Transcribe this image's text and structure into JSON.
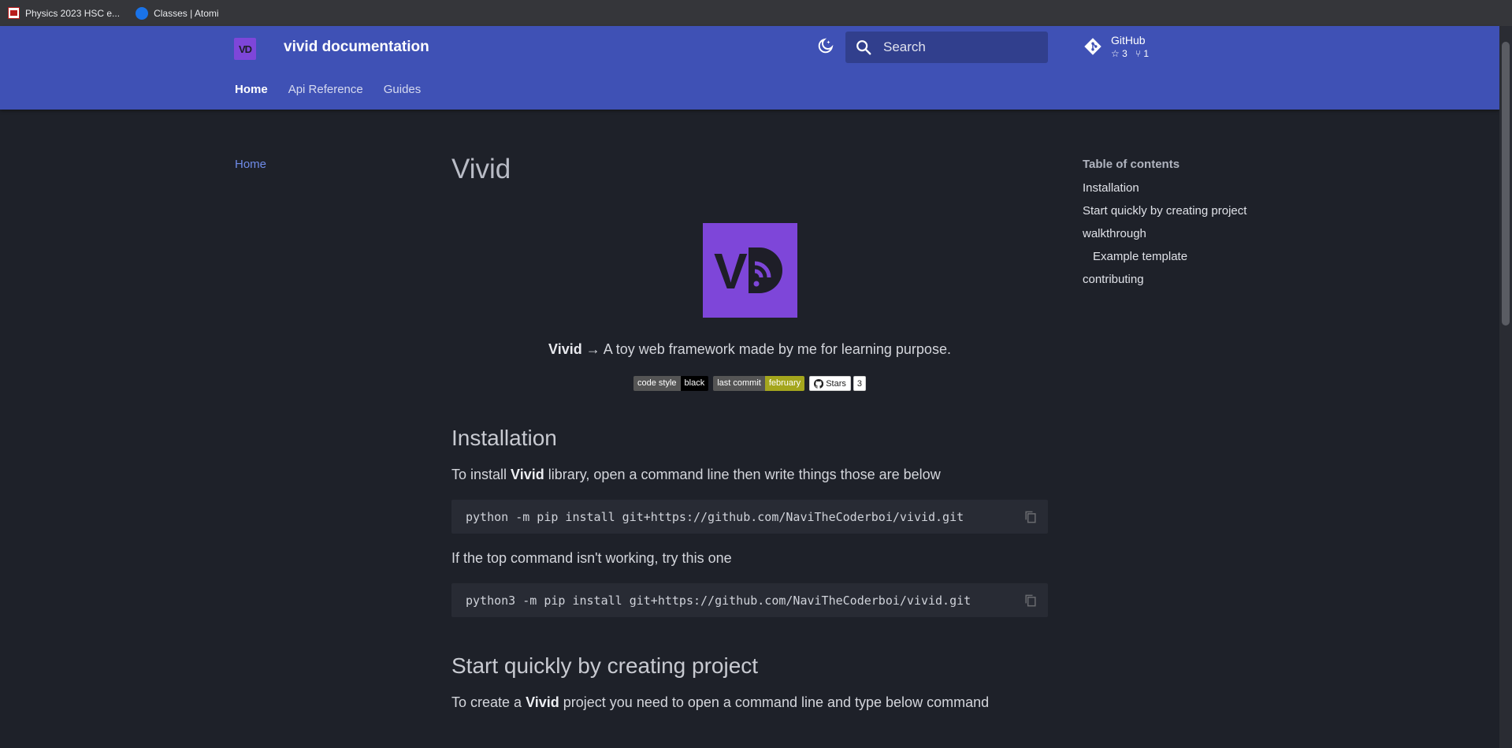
{
  "bookmarks": [
    {
      "label": "Physics 2023 HSC e..."
    },
    {
      "label": "Classes | Atomi"
    }
  ],
  "header": {
    "logo_text": "VD",
    "site_title": "vivid documentation",
    "search_placeholder": "Search",
    "repo": {
      "name": "GitHub",
      "stars": "3",
      "forks": "1"
    },
    "tabs": [
      {
        "label": "Home",
        "active": true
      },
      {
        "label": "Api Reference",
        "active": false
      },
      {
        "label": "Guides",
        "active": false
      }
    ]
  },
  "sidebar": {
    "items": [
      {
        "label": "Home"
      }
    ]
  },
  "main": {
    "title": "Vivid",
    "hero_logo_text": "VD",
    "tagline_bold": "Vivid",
    "tagline_rest": " → A toy web framework made by me for learning purpose.",
    "badges": [
      {
        "key": "code style",
        "value": "black"
      },
      {
        "key": "last commit",
        "value": "february"
      }
    ],
    "github_badge": {
      "label": "Stars",
      "count": "3"
    },
    "installation": {
      "heading": "Installation",
      "intro_pre": "To install ",
      "intro_bold": "Vivid",
      "intro_post": " library, open a command line then write things those are below",
      "command1": "python -m pip install git+https://github.com/NaviTheCoderboi/vivid.git",
      "fallback_text": "If the top command isn't working, try this one",
      "command2": "python3 -m pip install git+https://github.com/NaviTheCoderboi/vivid.git"
    },
    "quickstart": {
      "heading": "Start quickly by creating project",
      "intro_pre": "To create a ",
      "intro_bold": "Vivid",
      "intro_post": " project you need to open a command line and type below command"
    }
  },
  "toc": {
    "title": "Table of contents",
    "items": [
      {
        "label": "Installation"
      },
      {
        "label": "Start quickly by creating project"
      },
      {
        "label": "walkthrough"
      },
      {
        "label": "Example template"
      },
      {
        "label": "contributing"
      }
    ]
  },
  "colors": {
    "header_bg": "#3f51b5",
    "page_bg": "#1e2129",
    "logo_purple": "#7e46d9",
    "link": "#6f8be8",
    "badge_olive": "#a4a61d"
  }
}
